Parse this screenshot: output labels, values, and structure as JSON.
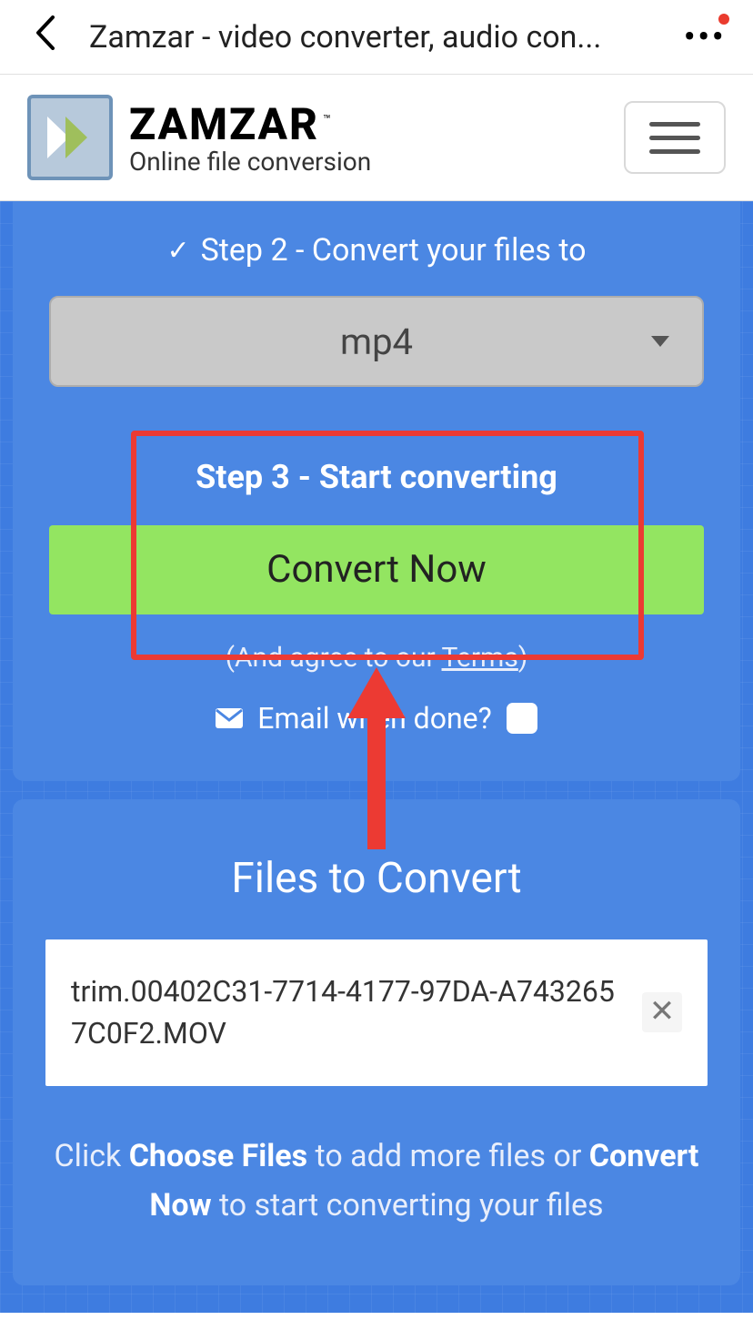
{
  "browser": {
    "title": "Zamzar - video converter, audio con..."
  },
  "brand": {
    "name": "ZAMZAR",
    "tm": "™",
    "tagline": "Online file conversion"
  },
  "step2": {
    "label": "Step 2 - Convert your files to",
    "selected": "mp4"
  },
  "step3": {
    "title": "Step 3 - Start converting",
    "button": "Convert Now",
    "terms_prefix": "(And agree to our ",
    "terms_link": "Terms",
    "terms_suffix": ")",
    "email_label": "Email when done?"
  },
  "files": {
    "title": "Files to Convert",
    "items": [
      {
        "name": "trim.00402C31-7714-4177-97DA-A7432657C0F2.MOV"
      }
    ],
    "instruction_parts": {
      "p1": "Click ",
      "b1": "Choose Files",
      "p2": " to add more files or ",
      "b2": "Convert Now",
      "p3": " to start converting your files"
    }
  }
}
